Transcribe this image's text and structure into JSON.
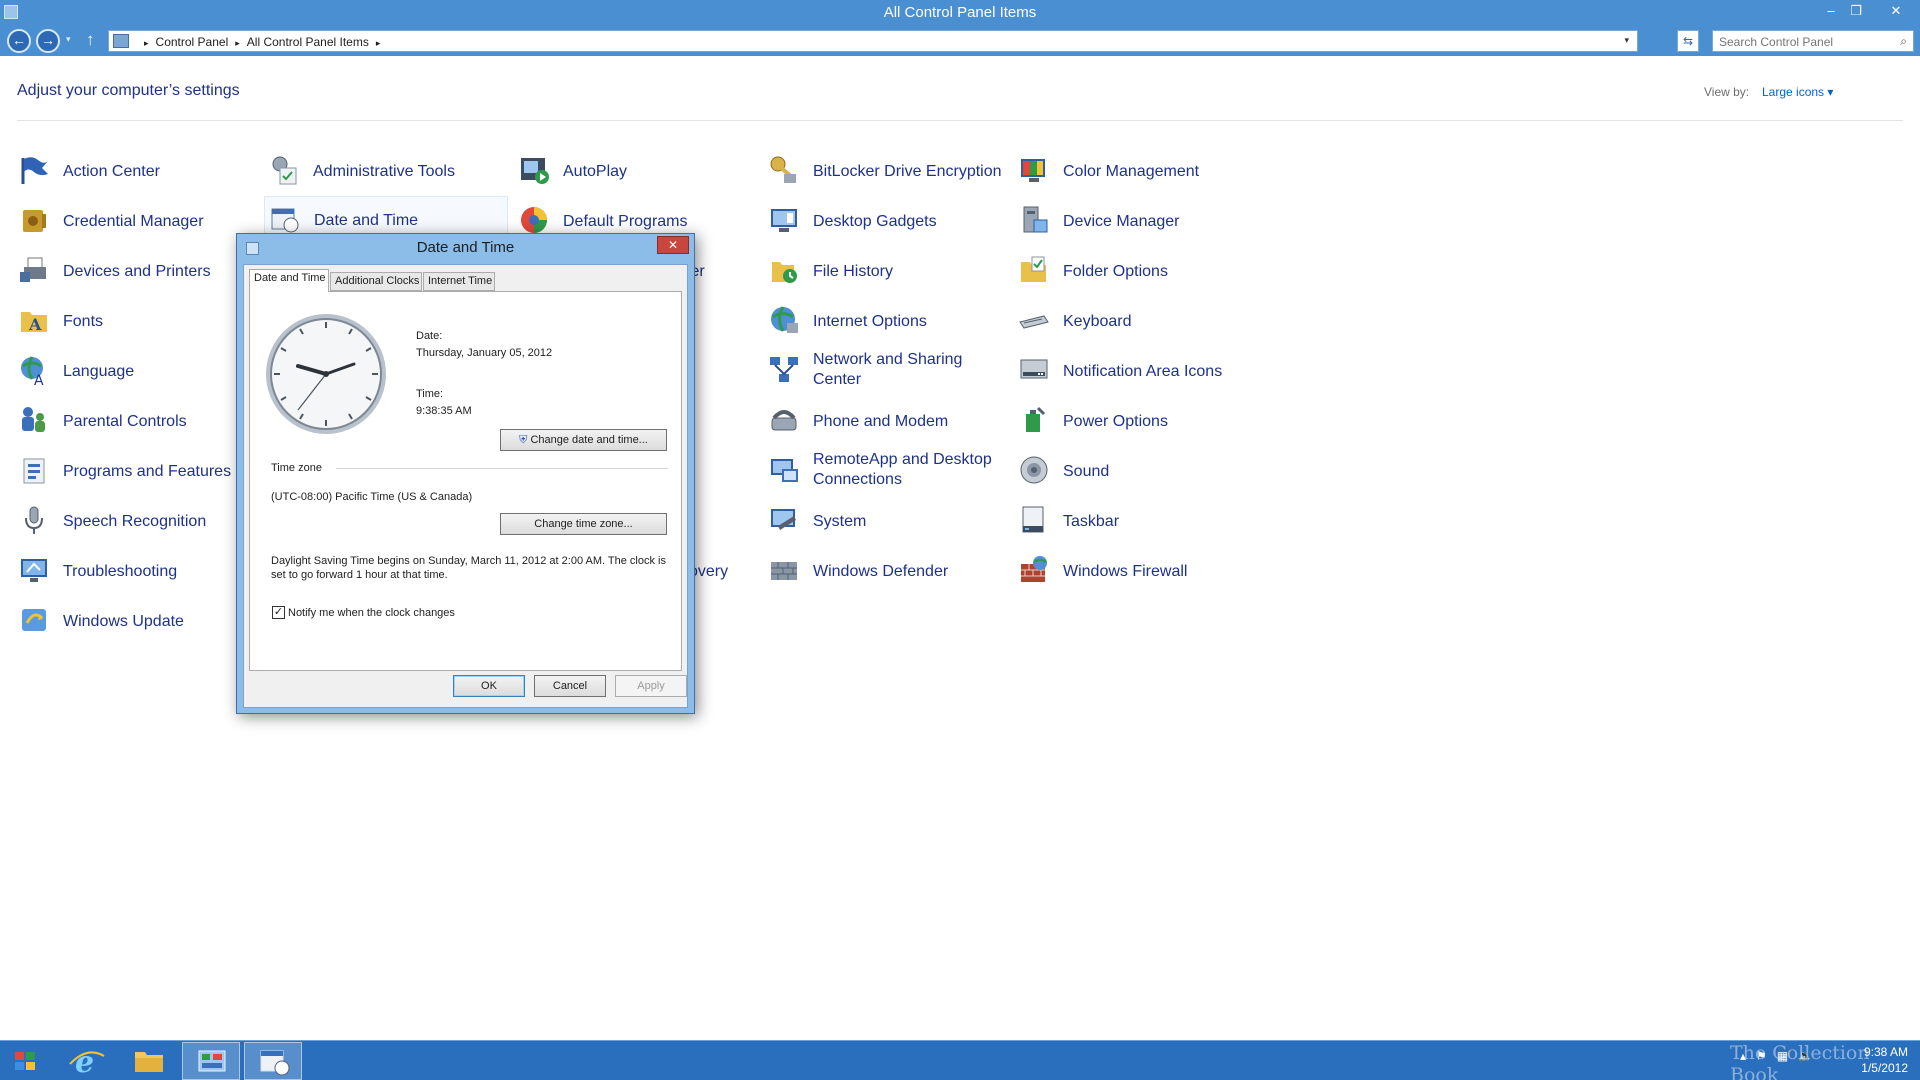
{
  "window": {
    "title": "All Control Panel Items",
    "minimize_glyph": "–",
    "maximize_glyph": "❐",
    "close_glyph": "✕"
  },
  "address": {
    "crumbs": [
      "Control Panel",
      "All Control Panel Items"
    ],
    "search_placeholder": "Search Control Panel"
  },
  "header": {
    "title": "Adjust your computer’s settings",
    "view_by_label": "View by:",
    "view_by_value": "Large icons ▾"
  },
  "items": {
    "col1": [
      "Action Center",
      "Credential Manager",
      "Devices and Printers",
      "Fonts",
      "Language",
      "Parental Controls",
      "Programs and Features",
      "Speech Recognition",
      "Troubleshooting",
      "Windows Update"
    ],
    "col2": [
      "Administrative Tools",
      "Date and Time"
    ],
    "col3": [
      "AutoPlay",
      "Default Programs",
      "ter",
      "overy"
    ],
    "col4": [
      "BitLocker Drive Encryption",
      "Desktop Gadgets",
      "File History",
      "Internet Options",
      "Network and Sharing Center",
      "Phone and Modem",
      "RemoteApp and Desktop Connections",
      "System",
      "Windows Defender"
    ],
    "col5": [
      "Color Management",
      "Device Manager",
      "Folder Options",
      "Keyboard",
      "Notification Area Icons",
      "Power Options",
      "Sound",
      "Taskbar",
      "Windows Firewall"
    ]
  },
  "dialog": {
    "title": "Date and Time",
    "close_glyph": "✕",
    "tabs": [
      "Date and Time",
      "Additional Clocks",
      "Internet Time"
    ],
    "date_label": "Date:",
    "date_value": "Thursday, January 05, 2012",
    "time_label": "Time:",
    "time_value": "9:38:35 AM",
    "change_datetime_btn": "Change date and time...",
    "timezone_label": "Time zone",
    "timezone_value": "(UTC-08:00) Pacific Time (US & Canada)",
    "change_tz_btn": "Change time zone...",
    "dst_text": "Daylight Saving Time begins on Sunday, March 11, 2012 at 2:00 AM. The clock is set to go forward 1 hour at that time.",
    "notify_label": "Notify me when the clock changes",
    "notify_checked": true,
    "ok": "OK",
    "cancel": "Cancel",
    "apply": "Apply"
  },
  "taskbar": {
    "time": "9:38 AM",
    "date": "1/5/2012",
    "watermark": "The Collection Book"
  }
}
